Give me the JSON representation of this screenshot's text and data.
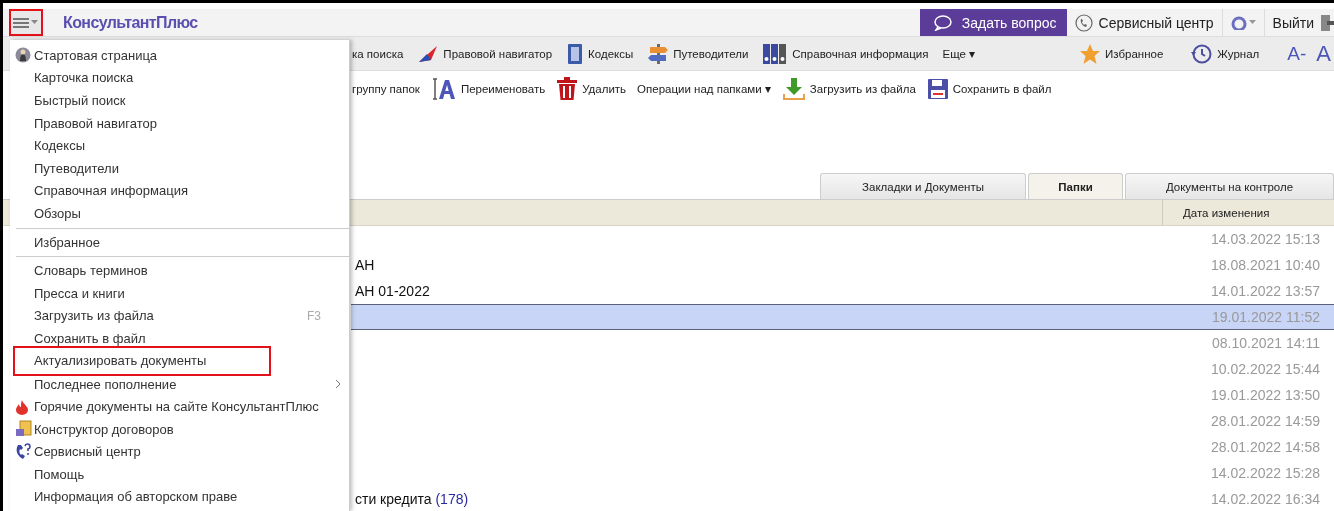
{
  "top_bar": {
    "menu_button": {
      "highlighted": true
    },
    "logo": "КонсультантПлюс",
    "ask_button": "Задать вопрос",
    "service_center": "Сервисный центр",
    "logout": "Выйти"
  },
  "toolbar": [
    {
      "label": "ка поиска"
    },
    {
      "label": "Правовой навигатор"
    },
    {
      "label": "Кодексы"
    },
    {
      "label": "Путеводители"
    },
    {
      "label": "Справочная информация"
    },
    {
      "label": "Еще ▾"
    }
  ],
  "toolbar_right": [
    {
      "label": "Избранное"
    },
    {
      "label": "Журнал"
    },
    {
      "label": "A-"
    },
    {
      "label": "A"
    }
  ],
  "folder_toolbar": [
    {
      "label": "группу папок"
    },
    {
      "label": "Переименовать"
    },
    {
      "label": "Удалить"
    },
    {
      "label": "Операции над папками ▾"
    },
    {
      "label": "Загрузить из файла"
    },
    {
      "label": "Сохранить в файл"
    }
  ],
  "tabs": [
    {
      "label": "Закладки и Документы",
      "selected": false
    },
    {
      "label": "Папки",
      "selected": true
    },
    {
      "label": "Документы на контроле",
      "selected": false
    }
  ],
  "table": {
    "columns": [
      "Дата изменения"
    ],
    "rows": [
      {
        "date": "14.03.2022 15:13",
        "selected": false
      },
      {
        "name": "АН",
        "date": "18.08.2021 10:40",
        "selected": false
      },
      {
        "name": "АН 01-2022",
        "date": "14.01.2022 13:57",
        "selected": false
      },
      {
        "date": "19.01.2022 11:52",
        "selected": true
      },
      {
        "date": "08.10.2021 14:11",
        "selected": false
      },
      {
        "date": "10.02.2022 15:44",
        "selected": false
      },
      {
        "date": "19.01.2022 13:50",
        "selected": false
      },
      {
        "date": "28.01.2022 14:59",
        "selected": false
      },
      {
        "date": "28.01.2022 14:58",
        "selected": false
      },
      {
        "date": "14.02.2022 15:28",
        "selected": false
      },
      {
        "name": "сти кредита",
        "count": "(178)",
        "date": "14.02.2022 16:34",
        "selected": false
      }
    ]
  },
  "menu": {
    "items": [
      {
        "kind": "item",
        "label": "Стартовая страница",
        "has_submenu": false,
        "highlighted": false
      },
      {
        "kind": "item",
        "label": "Карточка поиска",
        "has_submenu": false,
        "highlighted": false
      },
      {
        "kind": "item",
        "label": "Быстрый поиск",
        "has_submenu": false,
        "highlighted": false
      },
      {
        "kind": "item",
        "label": "Правовой навигатор",
        "has_submenu": false,
        "highlighted": false
      },
      {
        "kind": "item",
        "label": "Кодексы",
        "has_submenu": false,
        "highlighted": false
      },
      {
        "kind": "item",
        "label": "Путеводители",
        "has_submenu": false,
        "highlighted": false
      },
      {
        "kind": "item",
        "label": "Справочная информация",
        "has_submenu": false,
        "highlighted": false
      },
      {
        "kind": "item",
        "label": "Обзоры",
        "has_submenu": false,
        "highlighted": false
      },
      {
        "kind": "separator"
      },
      {
        "kind": "item",
        "label": "Избранное",
        "has_submenu": false,
        "highlighted": false
      },
      {
        "kind": "separator"
      },
      {
        "kind": "item",
        "label": "Словарь терминов",
        "has_submenu": false,
        "highlighted": false
      },
      {
        "kind": "item",
        "label": "Пресса и книги",
        "has_submenu": false,
        "highlighted": false
      },
      {
        "kind": "item",
        "label": "Загрузить из файла",
        "shortcut": "F3",
        "has_submenu": false,
        "highlighted": false
      },
      {
        "kind": "item",
        "label": "Сохранить в файл",
        "has_submenu": false,
        "highlighted": false
      },
      {
        "kind": "item",
        "label": "Актуализировать документы",
        "has_submenu": false,
        "highlighted": true
      },
      {
        "kind": "item",
        "label": "Последнее пополнение",
        "has_submenu": true,
        "highlighted": false
      },
      {
        "kind": "item",
        "label": "Горячие документы на сайте КонсультантПлюс",
        "has_submenu": false,
        "highlighted": false
      },
      {
        "kind": "item",
        "label": "Конструктор договоров",
        "has_submenu": false,
        "highlighted": false
      },
      {
        "kind": "item",
        "label": "Сервисный центр",
        "has_submenu": false,
        "highlighted": false
      },
      {
        "kind": "item",
        "label": "Помощь",
        "has_submenu": false,
        "highlighted": false
      },
      {
        "kind": "item",
        "label": "Информация об авторском праве",
        "has_submenu": false,
        "highlighted": false
      }
    ]
  }
}
